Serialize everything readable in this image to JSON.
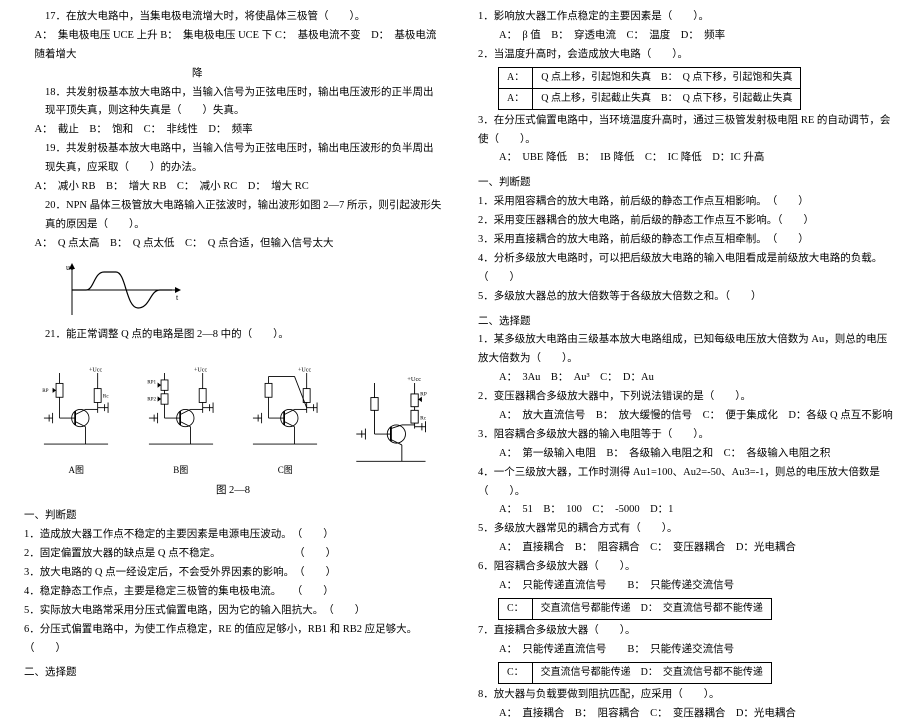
{
  "left": {
    "q17": "17．在放大电路中，当集电极电流增大时，将使晶体三极管（　　）。",
    "q17opts": "A：　集电极电压 UCE 上升 B：　集电极电压 UCE 下 C：　基极电流不变　D：　基极电流随着增大\n　　　　　　　　　　　　　　　降",
    "q18": "18．共发射极基本放大电路中，当输入信号为正弦电压时，输出电压波形的正半周出现平顶失真，则这种失真是（　　）失真。",
    "q18opts": "A：　截止　B：　饱和　C：　非线性　D：　频率",
    "q19": "19．共发射极基本放大电路中，当输入信号为正弦电压时，输出电压波形的负半周出现失真，应采取（　　）的办法。",
    "q19opts": "A：　减小 RB　B：　增大 RB　C：　减小 RC　D：　增大 RC",
    "q20": "20．NPN 晶体三极管放大电路输入正弦波时，输出波形如图 2—7 所示，则引起波形失真的原因是（　　）。",
    "q20opts": "A：　Q 点太高　B：　Q 点太低　C：　Q 点合适，但输入信号太大",
    "q21": "21．能正常调整 Q 点的电路是图 2—8 中的（　　）。",
    "fig_label_a": "A图",
    "fig_label_b": "B图",
    "fig_label_c": "C图",
    "fig_label_d": "",
    "fig_caption": "图 2—8",
    "sec1": "一、判断题",
    "j1": "1．造成放大器工作点不稳定的主要因素是电源电压波动。　（　　）",
    "j2": "2．固定偏置放大器的缺点是 Q 点不稳定。　　　　　　　　（　　）",
    "j3": "3．放大电路的 Q 点一经设定后，不会受外界因素的影响。　（　　）",
    "j4": "4．稳定静态工作点，主要是稳定三极管的集电极电流。　　（　　）",
    "j5": "5．实际放大电路常采用分压式偏置电路，因为它的输入阻抗大。　（　　）",
    "j6": "6．分压式偏置电路中，为使工作点稳定，RE 的值应足够小，RB1 和 RB2 应足够大。　（　　）",
    "sec2": "二、选择题"
  },
  "right": {
    "q1": "1．影响放大器工作点稳定的主要因素是（　　）。",
    "q1opts": "A：　β 值　B：　穿透电流　C：　温度　D：　频率",
    "q2": "2．当温度升高时，会造成放大电路（　　）。",
    "q2a": "A：",
    "q2a_txt": "Q 点上移，引起饱和失真　B：　Q 点下移，引起饱和失真",
    "q2b": "A：",
    "q2b_txt": "Q 点上移，引起截止失真　B：　Q 点下移，引起截止失真",
    "q3": "3．在分压式偏置电路中，当环境温度升高时，通过三极管发射极电阻 RE 的自动调节，会使（　　）。",
    "q3opts": "A：　UBE 降低　B：　IB 降低　C：　IC 降低　D：IC 升高",
    "secJ": "一、判断题",
    "rj1": "1．采用阻容耦合的放大电路，前后级的静态工作点互相影响。　（　　）",
    "rj2": "2．采用变压器耦合的放大电路，前后级的静态工作点互不影响。（　　）",
    "rj3": "3．采用直接耦合的放大电路，前后级的静态工作点互相牵制。　（　　）",
    "rj4": "4．分析多级放大电路时，可以把后级放大电路的输入电阻看成是前级放大电路的负载。（　　）",
    "rj5": "5．多级放大器总的放大倍数等于各级放大倍数之和。（　　）",
    "secS": "二、选择题",
    "rs1": "1．某多级放大电路由三级基本放大电路组成，已知每级电压放大倍数为 Au，则总的电压放大倍数为（　　）。",
    "rs1opts": "A：　3Au　B：　Au³　C：　D：Au",
    "rs2": "2．变压器耦合多级放大器中，下列说法错误的是（　　）。",
    "rs2opts": "A：　放大直流信号　B：　放大缓慢的信号　C：　便于集成化　D：各级 Q 点互不影响",
    "rs3": "3．阻容耦合多级放大器的输入电阻等于（　　）。",
    "rs3opts": "A：　第一级输入电阻　B：　各级输入电阻之和　C：　各级输入电阻之积",
    "rs4": "4．一个三级放大器，工作时测得 Au1=100、Au2=-50、Au3=-1，则总的电压放大倍数是（　　）。",
    "rs4opts": "A：　51　B：　100　C：　-5000　D：1",
    "rs5": "5．多级放大器常见的耦合方式有（　　）。",
    "rs5opts": "A：　直接耦合　B：　阻容耦合　C：　变压器耦合　D：光电耦合",
    "rs6": "6．阻容耦合多级放大器（　　）。",
    "rs6a": "A：　只能传递直流信号　　B：　只能传递交流信号",
    "rs6b": "C：",
    "rs6b_txt": "交直流信号都能传递　D：　交直流信号都不能传递",
    "rs7": "7．直接耦合多级放大器（　　）。",
    "rs7a": "A：　只能传递直流信号　　B：　只能传递交流信号",
    "rs7b": "C：",
    "rs7b_txt": "交直流信号都能传递　D：　交直流信号都不能传递",
    "rs8": "8．放大器与负载要做到阻抗匹配，应采用（　　）。",
    "rs8opts": "A：　直接耦合　B：　阻容耦合　C：　变压器耦合　D：光电耦合"
  }
}
